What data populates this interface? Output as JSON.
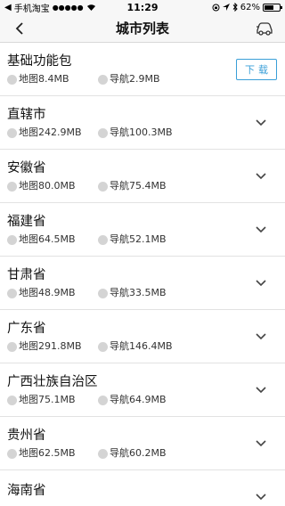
{
  "status_bar": {
    "carrier": "手机淘宝",
    "signal": "●●●●●",
    "time": "11:29",
    "battery_percent": "62%",
    "battery_level": 0.62
  },
  "nav": {
    "title": "城市列表"
  },
  "items": [
    {
      "name": "基础功能包",
      "map": "地图8.4MB",
      "nav": "导航2.9MB",
      "action": "下载"
    },
    {
      "name": "直辖市",
      "map": "地图242.9MB",
      "nav": "导航100.3MB"
    },
    {
      "name": "安徽省",
      "map": "地图80.0MB",
      "nav": "导航75.4MB"
    },
    {
      "name": "福建省",
      "map": "地图64.5MB",
      "nav": "导航52.1MB"
    },
    {
      "name": "甘肃省",
      "map": "地图48.9MB",
      "nav": "导航33.5MB"
    },
    {
      "name": "广东省",
      "map": "地图291.8MB",
      "nav": "导航146.4MB"
    },
    {
      "name": "广西壮族自治区",
      "map": "地图75.1MB",
      "nav": "导航64.9MB"
    },
    {
      "name": "贵州省",
      "map": "地图62.5MB",
      "nav": "导航60.2MB"
    },
    {
      "name": "海南省",
      "map": "",
      "nav": ""
    }
  ]
}
